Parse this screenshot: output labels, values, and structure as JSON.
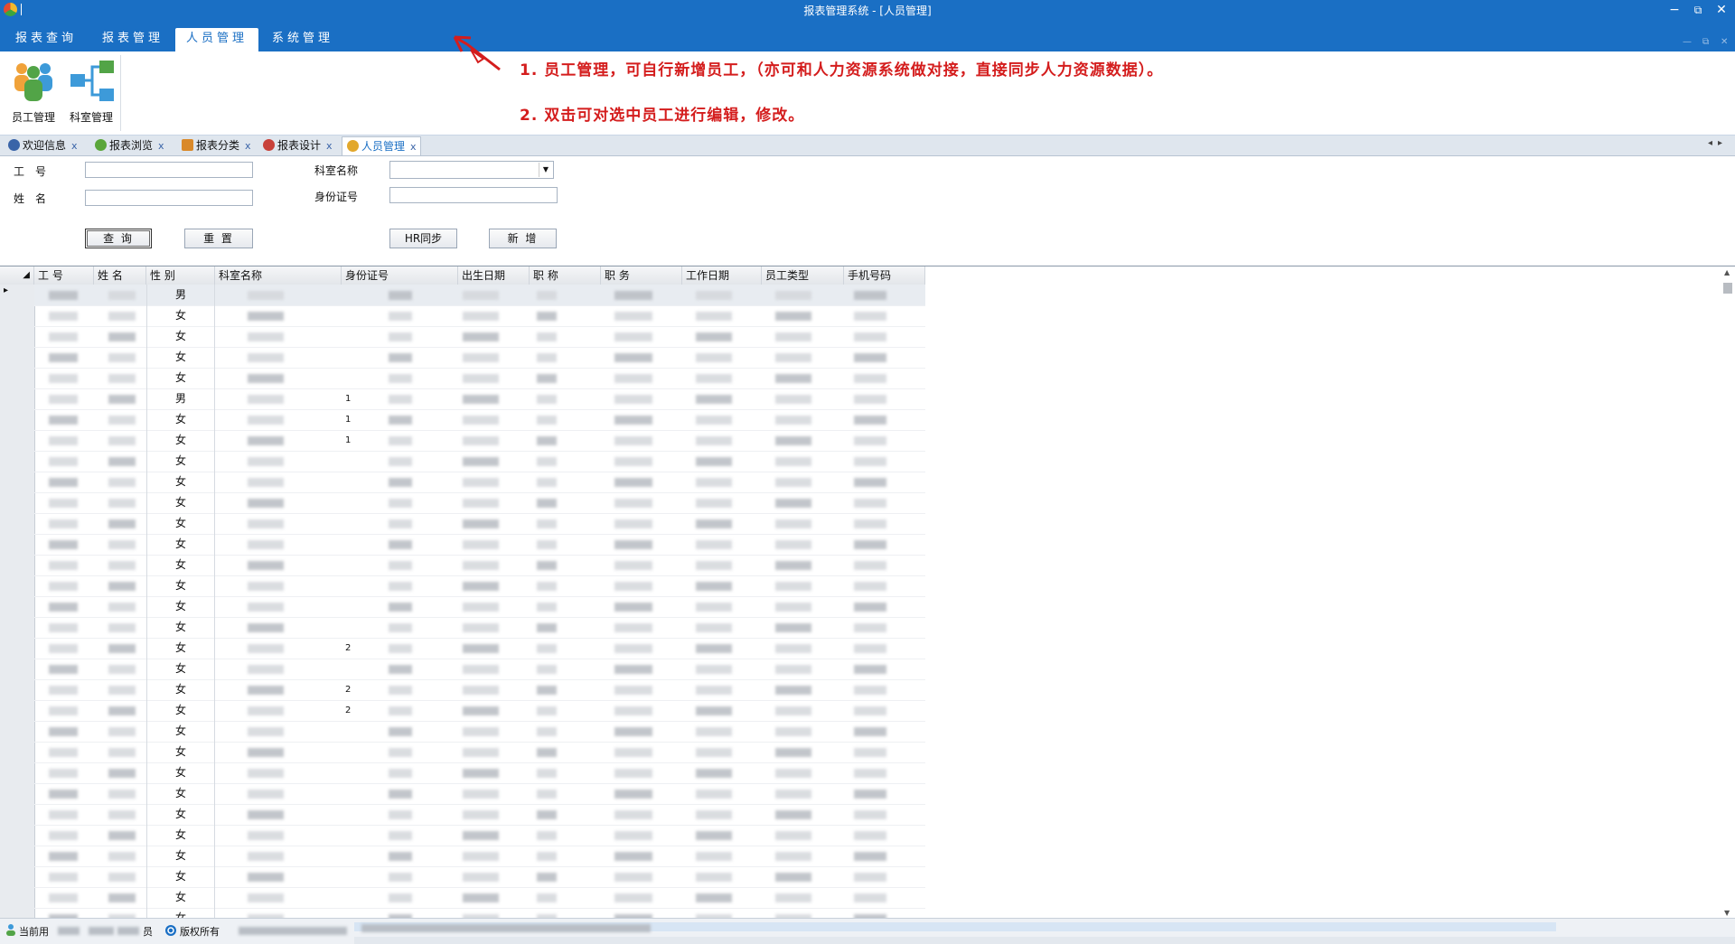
{
  "window": {
    "title": "报表管理系统 - [人员管理]",
    "controls": [
      "−",
      "⧉",
      "✕"
    ]
  },
  "ribbon_tabs": [
    {
      "label": "报表查询",
      "active": false
    },
    {
      "label": "报表管理",
      "active": false
    },
    {
      "label": "人员管理",
      "active": true
    },
    {
      "label": "系统管理",
      "active": false
    }
  ],
  "ribbon_buttons": [
    {
      "label": "员工管理",
      "icon": "staff-people-icon"
    },
    {
      "label": "科室管理",
      "icon": "department-tree-icon"
    }
  ],
  "annotations": [
    "1. 员工管理，可自行新增员工，（亦可和人力资源系统做对接，直接同步人力资源数据）。",
    "2. 双击可对选中员工进行编辑，修改。"
  ],
  "doc_tabs": [
    {
      "label": "欢迎信息",
      "icon": "welcome-icon",
      "color": "#3a64a8",
      "active": false
    },
    {
      "label": "报表浏览",
      "icon": "browse-icon",
      "color": "#5aa63a",
      "active": false
    },
    {
      "label": "报表分类",
      "icon": "category-icon",
      "color": "#d9892a",
      "active": false
    },
    {
      "label": "报表设计",
      "icon": "design-icon",
      "color": "#c8413a",
      "active": false
    },
    {
      "label": "人员管理",
      "icon": "staff-icon",
      "color": "#e2a82c",
      "active": true
    }
  ],
  "doc_tab_close": "x",
  "form": {
    "employee_no_label": "工　号",
    "employee_no_value": "",
    "name_label": "姓　名",
    "name_value": "",
    "dept_label": "科室名称",
    "dept_value": "",
    "idcard_label": "身份证号",
    "idcard_value": "",
    "query_button": "查 询",
    "reset_button": "重 置",
    "hr_sync_button": "HR同步",
    "add_button": "新 增"
  },
  "grid": {
    "columns": [
      "工 号",
      "姓 名",
      "性 别",
      "科室名称",
      "身份证号",
      "出生日期",
      "职 称",
      "职 务",
      "工作日期",
      "员工类型",
      "手机号码"
    ],
    "genders": [
      "男",
      "女",
      "女",
      "女",
      "女",
      "男",
      "女",
      "女",
      "女",
      "女",
      "女",
      "女",
      "女",
      "女",
      "女",
      "女",
      "女",
      "女",
      "女",
      "女",
      "女",
      "女",
      "女",
      "女",
      "女",
      "女",
      "女",
      "女",
      "女",
      "女",
      "女"
    ],
    "id_prefixes": {
      "5": "1",
      "6": "1",
      "7": "1",
      "17": "2",
      "19": "2",
      "20": "2"
    },
    "current_row_marker": "▸",
    "select_all_marker": "◢"
  },
  "statusbar": {
    "user_label": "当前用",
    "role_suffix": "员",
    "copyright_label": "版权所有"
  }
}
